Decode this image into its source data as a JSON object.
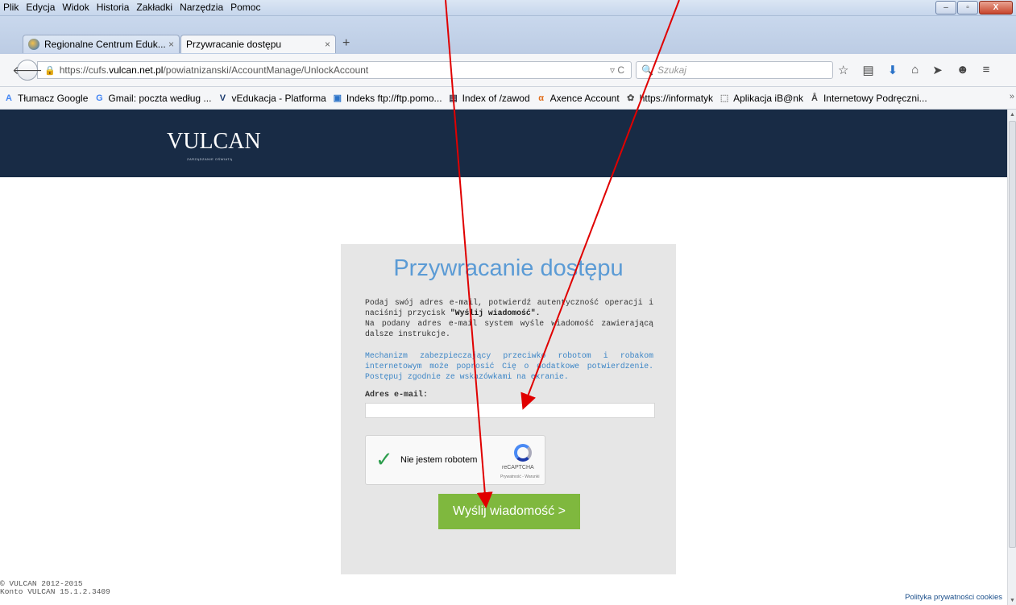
{
  "menu": [
    "Plik",
    "Edycja",
    "Widok",
    "Historia",
    "Zakładki",
    "Narzędzia",
    "Pomoc"
  ],
  "window_controls": {
    "minimize": "–",
    "maximize": "▫",
    "close": "X"
  },
  "tabs": [
    {
      "label": "Regionalne Centrum Eduk...",
      "close": "×"
    },
    {
      "label": "Przywracanie dostępu",
      "close": "×"
    }
  ],
  "new_tab": "+",
  "url": {
    "prefix": "https://cufs.",
    "host": "vulcan.net.pl",
    "path": "/powiatnizanski/AccountManage/UnlockAccount",
    "tail": "▿ C"
  },
  "search": {
    "placeholder": "Szukaj"
  },
  "bookmarks": [
    {
      "label": "Tłumacz Google",
      "icon": "translate-icon",
      "glyph": "A",
      "color": "#4285f4"
    },
    {
      "label": "Gmail: poczta według ...",
      "icon": "google-icon",
      "glyph": "G",
      "color": "#4285f4"
    },
    {
      "label": "vEdukacja - Platforma",
      "icon": "v-icon",
      "glyph": "V",
      "color": "#1a3a6e"
    },
    {
      "label": "Indeks ftp://ftp.pomo...",
      "icon": "monitor-icon",
      "glyph": "▣",
      "color": "#2a72c8"
    },
    {
      "label": "Index of /zawod",
      "icon": "folder-icon",
      "glyph": "▤",
      "color": "#334"
    },
    {
      "label": "Axence Account",
      "icon": "axence-icon",
      "glyph": "α",
      "color": "#e07020"
    },
    {
      "label": "https://informatyk",
      "icon": "globe-icon",
      "glyph": "✿",
      "color": "#555"
    },
    {
      "label": "Aplikacja iB@nk",
      "icon": "page-icon",
      "glyph": "⬚",
      "color": "#888"
    },
    {
      "label": "Internetowy Podręczni...",
      "icon": "book-icon",
      "glyph": "Å",
      "color": "#444"
    }
  ],
  "bookmarks_more": "»",
  "brand": {
    "logo": "VULCAN",
    "tagline": "ZARZĄDZANIE OŚWIATĄ"
  },
  "form": {
    "title": "Przywracanie dostępu",
    "intro_1": "Podaj swój adres e-mail, potwierdź autentyczność operacji i naciśnij przycisk ",
    "intro_bold": "\"Wyślij wiadomość\".",
    "intro_2": "Na podany adres e-mail system wyśle wiadomość zawierającą dalsze instrukcje.",
    "note": "Mechanizm zabezpieczający przeciwko robotom i robakom internetowym może poprosić Cię o dodatkowe potwierdzenie. Postępuj zgodnie ze wskazówkami na ekranie.",
    "email_label": "Adres e-mail:",
    "email_value": "",
    "captcha_label": "Nie jestem robotem",
    "captcha_brand": "reCAPTCHA",
    "captcha_links": "Prywatność - Warunki",
    "submit_label": "Wyślij wiadomość >"
  },
  "footer": {
    "copyright": "© VULCAN 2012-2015",
    "version": "Konto VULCAN 15.1.2.3409",
    "privacy": "Polityka prywatności cookies"
  },
  "colors": {
    "header_bg": "#182b45",
    "title": "#5b9bd5",
    "button": "#7fb83e",
    "arrows": "#e00000"
  }
}
